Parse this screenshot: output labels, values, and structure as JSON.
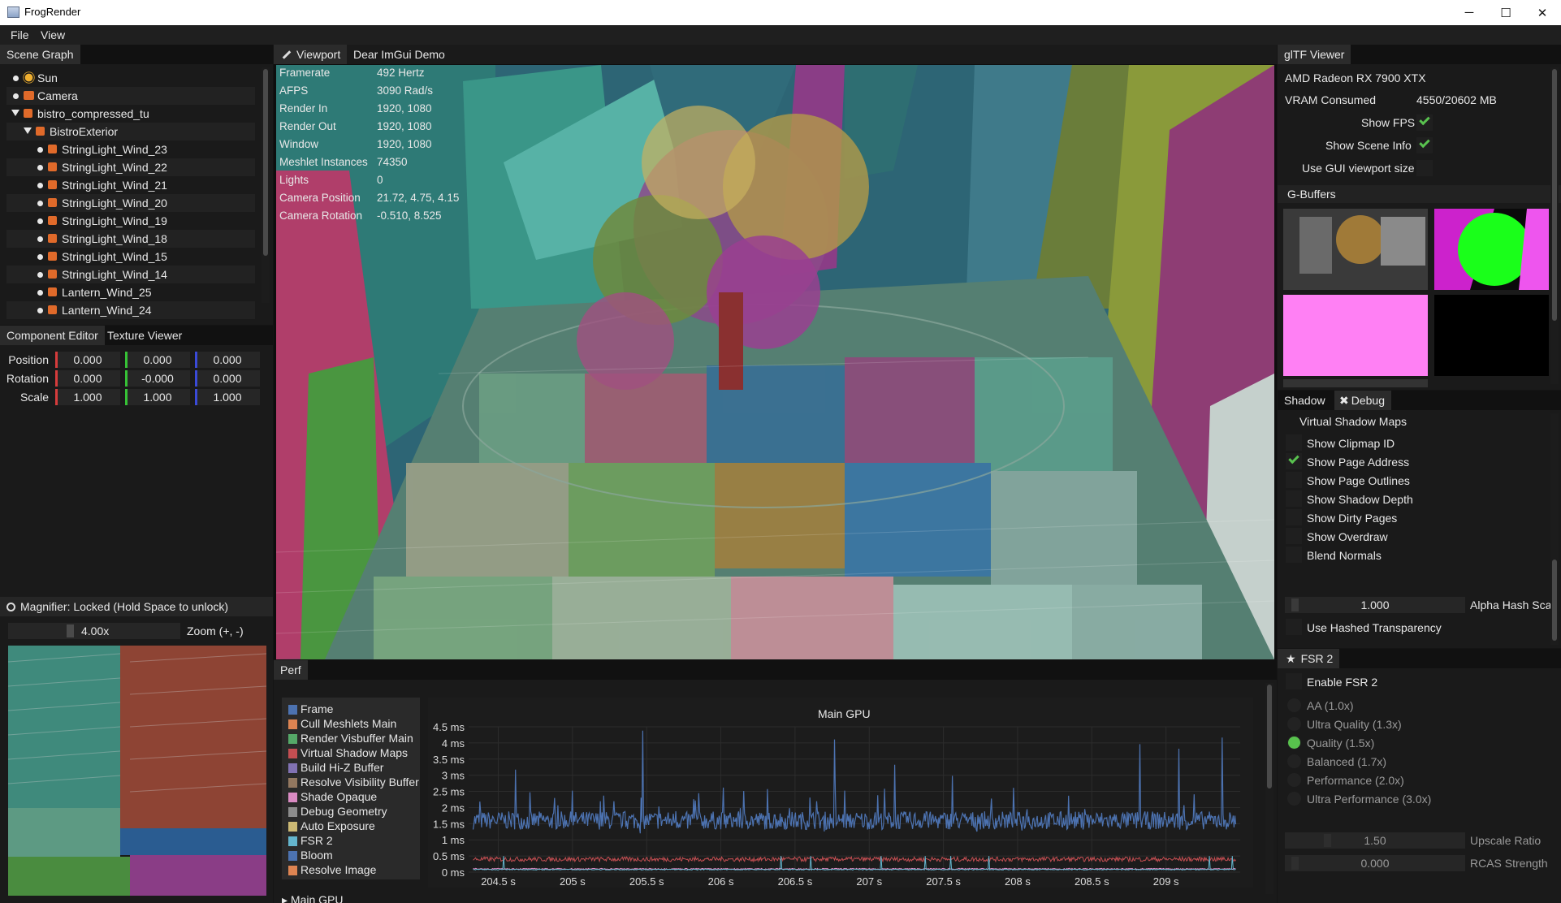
{
  "window": {
    "title": "FrogRender",
    "minimize": "─",
    "maximize": "☐",
    "close": "✕"
  },
  "menu": [
    "File",
    "View"
  ],
  "scene_graph": {
    "tab": "Scene Graph",
    "items": [
      {
        "label": "Sun",
        "icon": "sun-icon"
      },
      {
        "label": "Camera",
        "icon": "camera-icon"
      },
      {
        "label": "bistro_compressed_tu",
        "icon": "object-icon"
      },
      {
        "label": "BistroExterior",
        "icon": "object-icon"
      },
      {
        "label": "StringLight_Wind_23",
        "icon": "object-icon"
      },
      {
        "label": "StringLight_Wind_22",
        "icon": "object-icon"
      },
      {
        "label": "StringLight_Wind_21",
        "icon": "object-icon"
      },
      {
        "label": "StringLight_Wind_20",
        "icon": "object-icon"
      },
      {
        "label": "StringLight_Wind_19",
        "icon": "object-icon"
      },
      {
        "label": "StringLight_Wind_18",
        "icon": "object-icon"
      },
      {
        "label": "StringLight_Wind_15",
        "icon": "object-icon"
      },
      {
        "label": "StringLight_Wind_14",
        "icon": "object-icon"
      },
      {
        "label": "Lantern_Wind_25",
        "icon": "object-icon"
      },
      {
        "label": "Lantern_Wind_24",
        "icon": "object-icon"
      }
    ]
  },
  "component_editor": {
    "tabs": [
      "Component Editor",
      "Texture Viewer"
    ],
    "position_label": "Position",
    "position": [
      "0.000",
      "0.000",
      "0.000"
    ],
    "rotation_label": "Rotation",
    "rotation": [
      "0.000",
      "-0.000",
      "0.000"
    ],
    "scale_label": "Scale",
    "scale": [
      "1.000",
      "1.000",
      "1.000"
    ]
  },
  "magnifier": {
    "title": "Magnifier: Locked (Hold Space to unlock)",
    "zoom_value": "4.00x",
    "zoom_label": "Zoom (+, -)"
  },
  "viewport": {
    "tabs": [
      "Viewport",
      "Dear ImGui Demo"
    ],
    "stats": [
      {
        "label": "Framerate",
        "value": "492 Hertz"
      },
      {
        "label": "AFPS",
        "value": "3090 Rad/s"
      },
      {
        "label": "Render In",
        "value": "1920, 1080"
      },
      {
        "label": "Render Out",
        "value": "1920, 1080"
      },
      {
        "label": "Window",
        "value": "1920, 1080"
      },
      {
        "label": "Meshlet Instances",
        "value": "74350"
      },
      {
        "label": "Lights",
        "value": "0"
      },
      {
        "label": "Camera Position",
        "value": "21.72, 4.75, 4.15"
      },
      {
        "label": "Camera Rotation",
        "value": "-0.510, 8.525"
      }
    ]
  },
  "perf": {
    "tab": "Perf",
    "chart_title": "Main GPU",
    "collapsed_header": "Main GPU",
    "legend": [
      {
        "name": "Frame",
        "color": "#4c72b0"
      },
      {
        "name": "Cull Meshlets Main",
        "color": "#dd8452"
      },
      {
        "name": "Render Visbuffer Main",
        "color": "#55a868"
      },
      {
        "name": "Virtual Shadow Maps",
        "color": "#c44e52"
      },
      {
        "name": "Build Hi-Z Buffer",
        "color": "#8172b3"
      },
      {
        "name": "Resolve Visibility Buffer",
        "color": "#937860"
      },
      {
        "name": "Shade Opaque",
        "color": "#da8bc3"
      },
      {
        "name": "Debug Geometry",
        "color": "#8c8c8c"
      },
      {
        "name": "Auto Exposure",
        "color": "#ccb974"
      },
      {
        "name": "FSR 2",
        "color": "#64b5cd"
      },
      {
        "name": "Bloom",
        "color": "#4c72b0"
      },
      {
        "name": "Resolve Image",
        "color": "#dd8452"
      }
    ],
    "y_ticks": [
      "4.5 ms",
      "4 ms",
      "3.5 ms",
      "3 ms",
      "2.5 ms",
      "2 ms",
      "1.5 ms",
      "1 ms",
      "0.5 ms",
      "0 ms"
    ],
    "x_ticks": [
      "204.5 s",
      "205 s",
      "205.5 s",
      "206 s",
      "206.5 s",
      "207 s",
      "207.5 s",
      "208 s",
      "208.5 s",
      "209 s"
    ]
  },
  "chart_data": {
    "type": "line",
    "title": "Main GPU",
    "xlim": [
      204.3,
      209.5
    ],
    "ylim": [
      0,
      4.5
    ],
    "x_ticks": [
      204.5,
      205,
      205.5,
      206,
      206.5,
      207,
      207.5,
      208,
      208.5,
      209
    ],
    "y_ticks": [
      0,
      0.5,
      1,
      1.5,
      2,
      2.5,
      3,
      3.5,
      4,
      4.5
    ],
    "grid": true,
    "legend_position": "left",
    "series": [
      {
        "name": "Frame",
        "mean": 1.6,
        "range": [
          1.2,
          4.4
        ]
      },
      {
        "name": "Virtual Shadow Maps",
        "mean": 0.4,
        "range": [
          0.35,
          0.55
        ]
      },
      {
        "name": "Shade Opaque",
        "mean": 0.1,
        "range": [
          0.05,
          0.15
        ]
      },
      {
        "name": "FSR 2",
        "mean": 0.08,
        "range": [
          0.05,
          0.5
        ]
      }
    ]
  },
  "gltf_viewer": {
    "tab": "glTF Viewer",
    "gpu": "AMD Radeon RX 7900 XTX",
    "vram_label": "VRAM Consumed",
    "vram_value": "4550/20602 MB",
    "show_fps": "Show FPS",
    "show_scene_info": "Show Scene Info",
    "use_gui_viewport": "Use GUI viewport size",
    "gbuffers": "G-Buffers"
  },
  "debug": {
    "tabs": [
      "Shadow",
      "Debug"
    ],
    "heading": "Virtual Shadow Maps",
    "options": [
      {
        "label": "Show Clipmap ID",
        "checked": false
      },
      {
        "label": "Show Page Address",
        "checked": true
      },
      {
        "label": "Show Page Outlines",
        "checked": false
      },
      {
        "label": "Show Shadow Depth",
        "checked": false
      },
      {
        "label": "Show Dirty Pages",
        "checked": false
      },
      {
        "label": "Show Overdraw",
        "checked": false
      },
      {
        "label": "Blend Normals",
        "checked": false
      }
    ],
    "alpha_hash_value": "1.000",
    "alpha_hash_label": "Alpha Hash Sca",
    "hashed_transparency": "Use Hashed Transparency"
  },
  "fsr": {
    "tab": "FSR 2",
    "enable": "Enable FSR 2",
    "modes": [
      {
        "label": "AA (1.0x)",
        "selected": false
      },
      {
        "label": "Ultra Quality (1.3x)",
        "selected": false
      },
      {
        "label": "Quality (1.5x)",
        "selected": true
      },
      {
        "label": "Balanced (1.7x)",
        "selected": false
      },
      {
        "label": "Performance (2.0x)",
        "selected": false
      },
      {
        "label": "Ultra Performance (3.0x)",
        "selected": false
      }
    ],
    "upscale_value": "1.50",
    "upscale_label": "Upscale Ratio",
    "rcas_value": "0.000",
    "rcas_label": "RCAS Strength"
  }
}
